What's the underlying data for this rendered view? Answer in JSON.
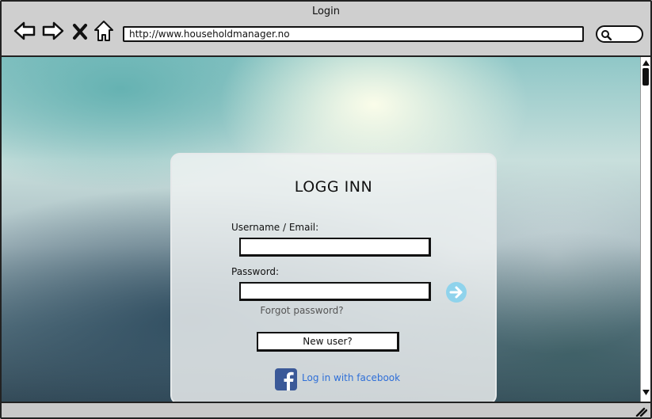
{
  "window": {
    "title": "Login"
  },
  "toolbar": {
    "back_icon": "back-arrow-icon",
    "forward_icon": "forward-arrow-icon",
    "stop_icon": "close-icon",
    "home_icon": "home-icon",
    "url": "http://www.householdmanager.no",
    "search_icon": "search-icon"
  },
  "login": {
    "title": "LOGG INN",
    "username_label": "Username / Email:",
    "username_value": "",
    "password_label": "Password:",
    "password_value": "",
    "submit_icon": "arrow-right-circle-icon",
    "forgot_password": "Forgot password?",
    "new_user": "New user?",
    "facebook_icon": "facebook-icon",
    "facebook_login": "Log in with facebook"
  },
  "colors": {
    "facebook_blue": "#3b5998",
    "link_blue": "#2f6fd8",
    "go_arrow": "#8fd3ec"
  }
}
